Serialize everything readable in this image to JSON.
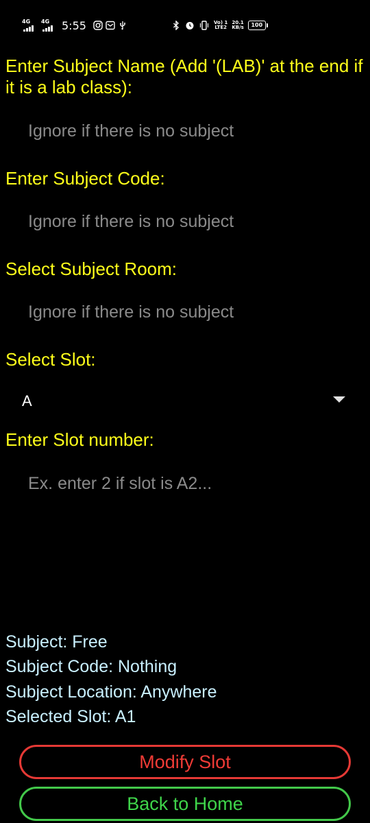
{
  "status_bar": {
    "sim1_network": "4G",
    "sim2_network": "4G",
    "time": "5:55",
    "left_icons": [
      "instagram-icon",
      "mail-icon",
      "usb-icon"
    ],
    "right_icons": [
      "bluetooth-icon",
      "alarm-icon",
      "vibrate-icon"
    ],
    "volte_line1": "Vo) 1",
    "volte_line2": "LTE2",
    "speed_value": "20.1",
    "speed_unit": "KB/s",
    "battery": "100"
  },
  "form": {
    "subject_name_label": "Enter Subject Name (Add '(LAB)' at the end if it is a lab class):",
    "subject_name_value": "",
    "subject_name_placeholder": "Ignore if there is no subject",
    "subject_code_label": "Enter Subject Code:",
    "subject_code_value": "",
    "subject_code_placeholder": "Ignore if there is no subject",
    "subject_room_label": "Select Subject Room:",
    "subject_room_value": "",
    "subject_room_placeholder": "Ignore if there is no subject",
    "slot_label": "Select Slot:",
    "slot_selected": "A",
    "slot_number_label": "Enter Slot number:",
    "slot_number_value": "",
    "slot_number_placeholder": "Ex. enter 2 if slot is A2..."
  },
  "summary": {
    "subject": "Subject: Free",
    "subject_code": "Subject Code: Nothing",
    "subject_location": "Subject Location: Anywhere",
    "selected_slot": "Selected Slot: A1"
  },
  "buttons": {
    "modify_label": "Modify Slot",
    "home_label": "Back to Home"
  },
  "colors": {
    "background": "#000000",
    "label": "#ffff1a",
    "placeholder": "#8a8a8a",
    "summary_text": "#c9f0ff",
    "modify_accent": "#e53935",
    "home_accent": "#43c84a"
  }
}
